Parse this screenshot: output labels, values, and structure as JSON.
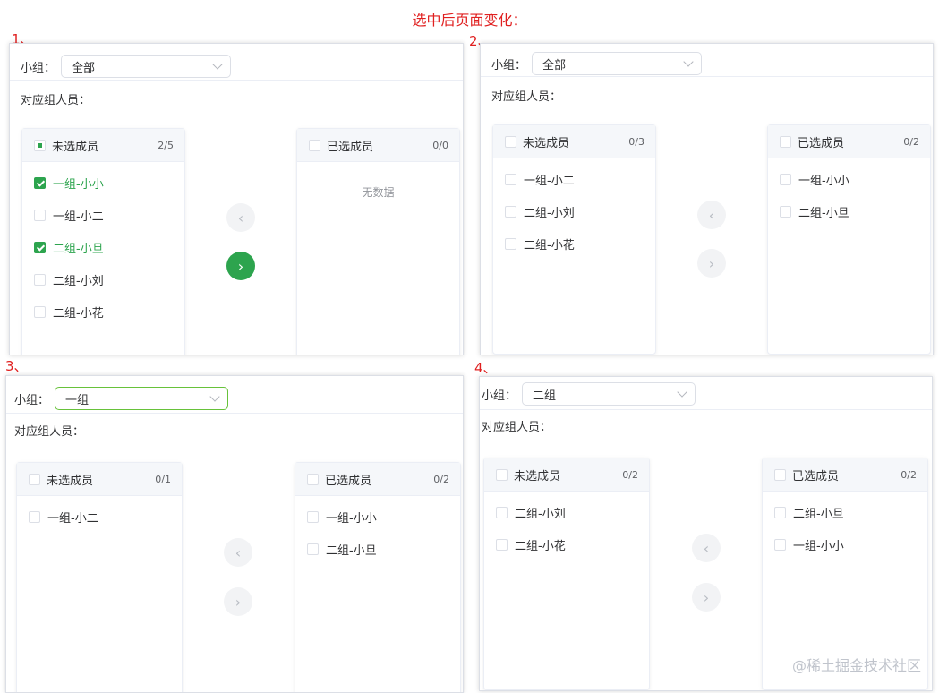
{
  "title": "选中后页面变化：",
  "labels": {
    "group": "小组：",
    "members": "对应组人员：",
    "left_title": "未选成员",
    "right_title": "已选成员",
    "empty": "无数据",
    "arrow_left": "‹",
    "arrow_right": "›"
  },
  "steps": [
    {
      "num": "1、",
      "select": "全部",
      "left_count": "2/5",
      "right_count": "0/0",
      "left_items": [
        {
          "label": "一组-小小",
          "checked": true
        },
        {
          "label": "一组-小二",
          "checked": false
        },
        {
          "label": "二组-小旦",
          "checked": true
        },
        {
          "label": "二组-小刘",
          "checked": false
        },
        {
          "label": "二组-小花",
          "checked": false
        }
      ],
      "right_items": [],
      "right_arrow_active": true
    },
    {
      "num": "2、",
      "select": "全部",
      "left_count": "0/3",
      "right_count": "0/2",
      "left_items": [
        {
          "label": "一组-小二",
          "checked": false
        },
        {
          "label": "二组-小刘",
          "checked": false
        },
        {
          "label": "二组-小花",
          "checked": false
        }
      ],
      "right_items": [
        {
          "label": "一组-小小",
          "checked": false
        },
        {
          "label": "二组-小旦",
          "checked": false
        }
      ],
      "right_arrow_active": false
    },
    {
      "num": "3、",
      "select": "一组",
      "left_count": "0/1",
      "right_count": "0/2",
      "left_items": [
        {
          "label": "一组-小二",
          "checked": false
        }
      ],
      "right_items": [
        {
          "label": "一组-小小",
          "checked": false
        },
        {
          "label": "二组-小旦",
          "checked": false
        }
      ],
      "right_arrow_active": false
    },
    {
      "num": "4、",
      "select": "二组",
      "left_count": "0/2",
      "right_count": "0/2",
      "left_items": [
        {
          "label": "二组-小刘",
          "checked": false
        },
        {
          "label": "二组-小花",
          "checked": false
        }
      ],
      "right_items": [
        {
          "label": "二组-小旦",
          "checked": false
        },
        {
          "label": "一组-小小",
          "checked": false
        }
      ],
      "right_arrow_active": false
    }
  ],
  "watermark": "@稀土掘金技术社区",
  "colors": {
    "accent": "#2da44e",
    "title": "#e02020",
    "border": "#dcdfe6"
  }
}
